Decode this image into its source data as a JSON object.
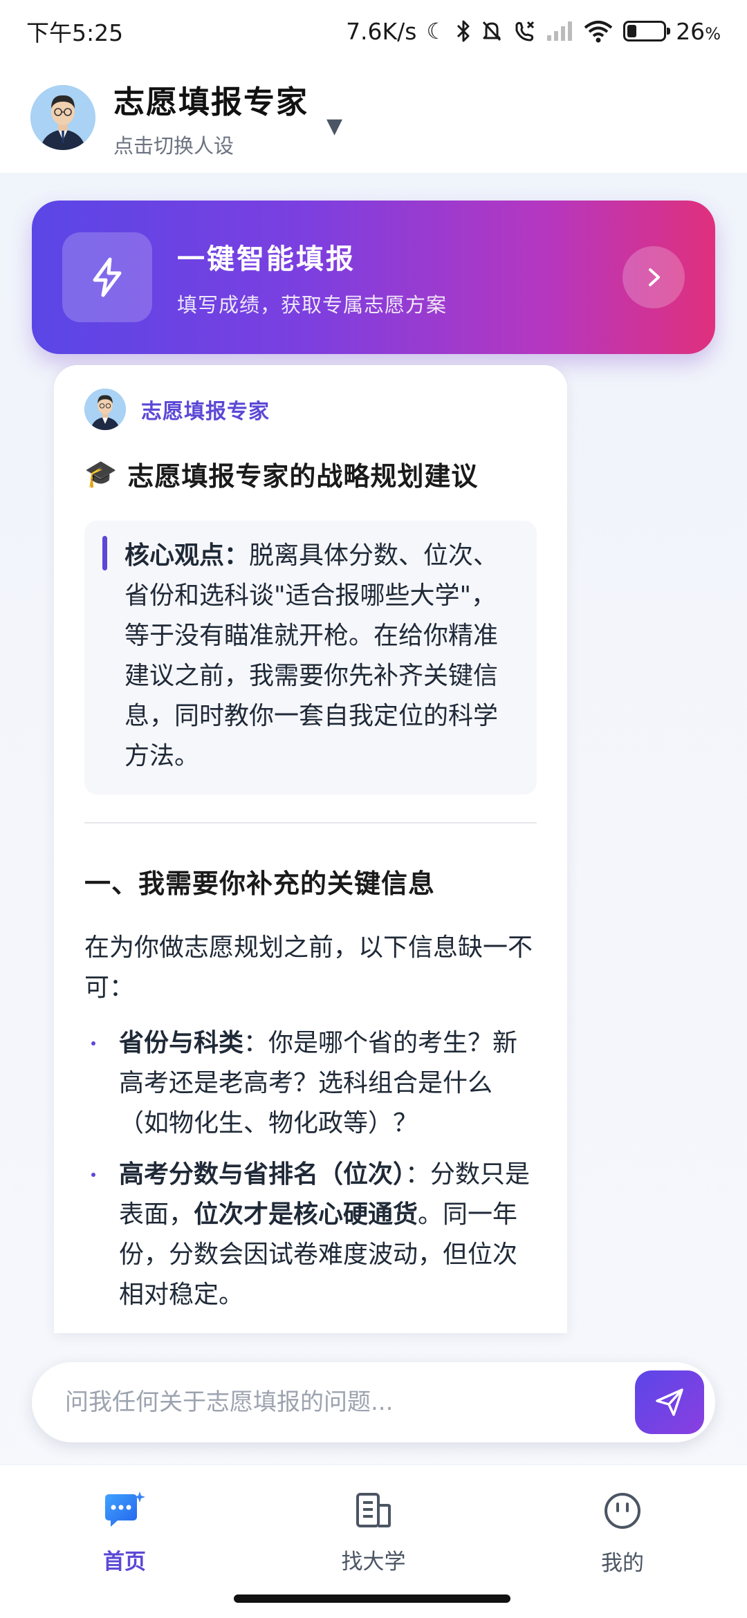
{
  "status_bar": {
    "time": "下午5:25",
    "network_speed": "7.6K/s",
    "battery_percent": "26",
    "battery_unit": "%",
    "battery_level": 0.26,
    "icons": [
      "moon-icon",
      "bluetooth-icon",
      "mute-icon",
      "call-off-icon",
      "signal-icon",
      "wifi-icon",
      "battery-icon"
    ]
  },
  "header": {
    "title": "志愿填报专家",
    "subtitle": "点击切换人设",
    "caret": "▼"
  },
  "promo": {
    "title": "一键智能填报",
    "subtitle": "填写成绩，获取专属志愿方案",
    "icon": "lightning-icon",
    "arrow_icon": "chevron-right-icon"
  },
  "message": {
    "sender": "志愿填报专家",
    "title_emoji": "🎓",
    "title": "志愿填报专家的战略规划建议",
    "quote_label": "核心观点：",
    "quote_text": "脱离具体分数、位次、省份和选科谈\"适合报哪些大学\"，等于没有瞄准就开枪。在给你精准建议之前，我需要你先补齐关键信息，同时教你一套自我定位的科学方法。",
    "section1_title": "一、我需要你补充的关键信息",
    "section1_intro": "在为你做志愿规划之前，以下信息缺一不可：",
    "bullets": [
      {
        "label": "省份与科类",
        "text": "：你是哪个省的考生？新高考还是老高考？选科组合是什么（如物化生、物化政等）？"
      },
      {
        "label": "高考分数与省排名（位次）",
        "text_a": "：分数只是表面，",
        "bold": "位次才是核心硬通货",
        "text_b": "。同一年份，分数会因试卷难度波动，但位次相对稳定。"
      }
    ]
  },
  "input": {
    "placeholder": "问我任何关于志愿填报的问题...",
    "send_icon": "send-icon"
  },
  "nav": {
    "items": [
      {
        "label": "首页",
        "icon": "chat-sparkle-icon",
        "active": true
      },
      {
        "label": "找大学",
        "icon": "building-icon",
        "active": false
      },
      {
        "label": "我的",
        "icon": "smile-icon",
        "active": false
      }
    ]
  },
  "colors": {
    "accent": "#5b48d6",
    "promo_gradient_start": "#5a46e6",
    "promo_gradient_end": "#e0307d"
  }
}
